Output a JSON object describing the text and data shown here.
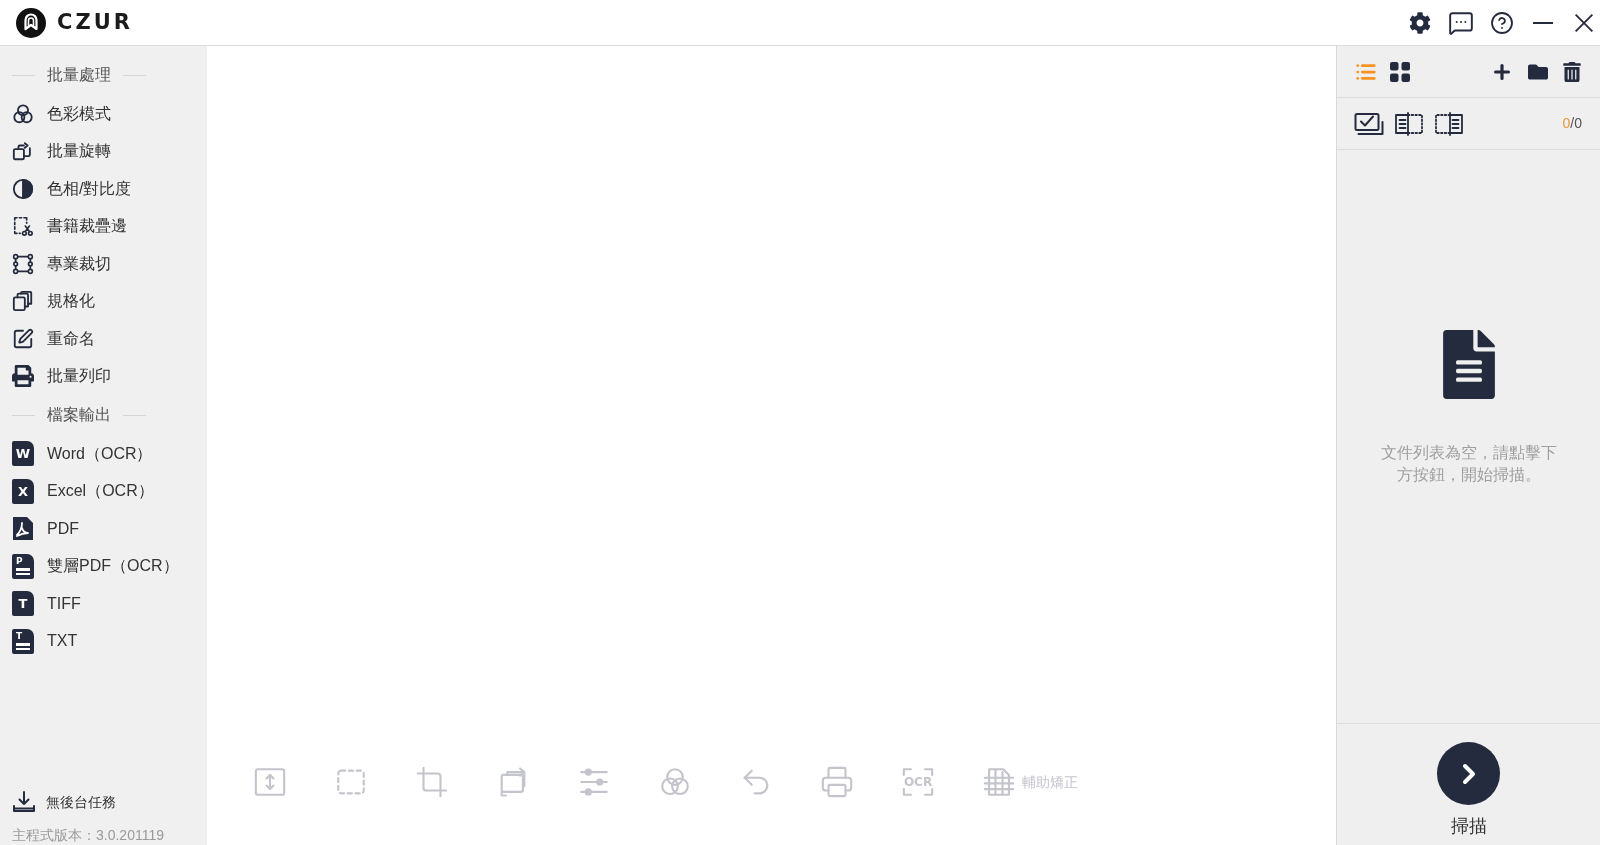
{
  "title_bar": {
    "logo_text": "CZUR"
  },
  "sidebar": {
    "sections": [
      {
        "heading": "批量處理",
        "items": [
          {
            "label": "色彩模式"
          },
          {
            "label": "批量旋轉"
          },
          {
            "label": "色相/對比度"
          },
          {
            "label": "書籍裁疊邊"
          },
          {
            "label": "專業裁切"
          },
          {
            "label": "規格化"
          },
          {
            "label": "重命名"
          },
          {
            "label": "批量列印"
          }
        ]
      },
      {
        "heading": "檔案輸出",
        "items": [
          {
            "label": "Word（OCR）",
            "kind": "letter",
            "badge": "W"
          },
          {
            "label": "Excel（OCR）",
            "kind": "letter",
            "badge": "X"
          },
          {
            "label": "PDF",
            "kind": "pdf"
          },
          {
            "label": "雙層PDF（OCR）",
            "kind": "lined",
            "badge": "P"
          },
          {
            "label": "TIFF",
            "kind": "letter",
            "badge": "T"
          },
          {
            "label": "TXT",
            "kind": "lined",
            "badge": "T"
          }
        ]
      }
    ],
    "background_tasks": "無後台任務",
    "version": "主程式版本：3.0.201119"
  },
  "canvas_toolbar": [
    {
      "kind": "fit",
      "disabled": true
    },
    {
      "kind": "select",
      "disabled": true
    },
    {
      "kind": "crop",
      "disabled": true
    },
    {
      "kind": "rotate",
      "disabled": true
    },
    {
      "kind": "adjust",
      "disabled": true
    },
    {
      "kind": "color",
      "disabled": true
    },
    {
      "kind": "undo",
      "disabled": true
    },
    {
      "kind": "print",
      "disabled": true
    },
    {
      "kind": "ocr",
      "text": "OCR",
      "disabled": true
    },
    {
      "kind": "correct",
      "label": "輔助矯正",
      "disabled": true
    }
  ],
  "file_panel": {
    "view_modes": [
      {
        "kind": "list",
        "selected": true
      },
      {
        "kind": "grid",
        "selected": false
      }
    ],
    "counter": {
      "selected": "0",
      "total": "/0"
    },
    "empty_message": "文件列表為空，請點擊下方按鈕，開始掃描。",
    "scan_label": "掃描"
  }
}
